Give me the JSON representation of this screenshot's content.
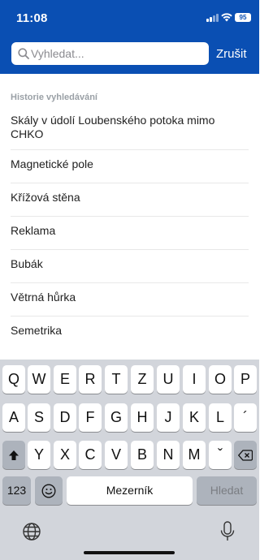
{
  "status_bar": {
    "time": "11:08",
    "battery": "95"
  },
  "search": {
    "placeholder": "Vyhledat...",
    "value": "",
    "cancel_label": "Zrušit"
  },
  "history": {
    "title": "Historie vyhledávání",
    "items": [
      "Skály v údolí Loubenského potoka mimo CHKO",
      "Magnetické pole",
      "Křížová stěna",
      "Reklama",
      "Bubák",
      "Větrná hůrka",
      "Semetrika"
    ]
  },
  "keyboard": {
    "row1": [
      "Q",
      "W",
      "E",
      "R",
      "T",
      "Z",
      "U",
      "I",
      "O",
      "P"
    ],
    "row2": [
      "A",
      "S",
      "D",
      "F",
      "G",
      "H",
      "J",
      "K",
      "L",
      "´"
    ],
    "row3": [
      "Y",
      "X",
      "C",
      "V",
      "B",
      "N",
      "M",
      "ˇ"
    ],
    "numbers_label": "123",
    "space_label": "Mezerník",
    "search_label": "Hledat"
  }
}
